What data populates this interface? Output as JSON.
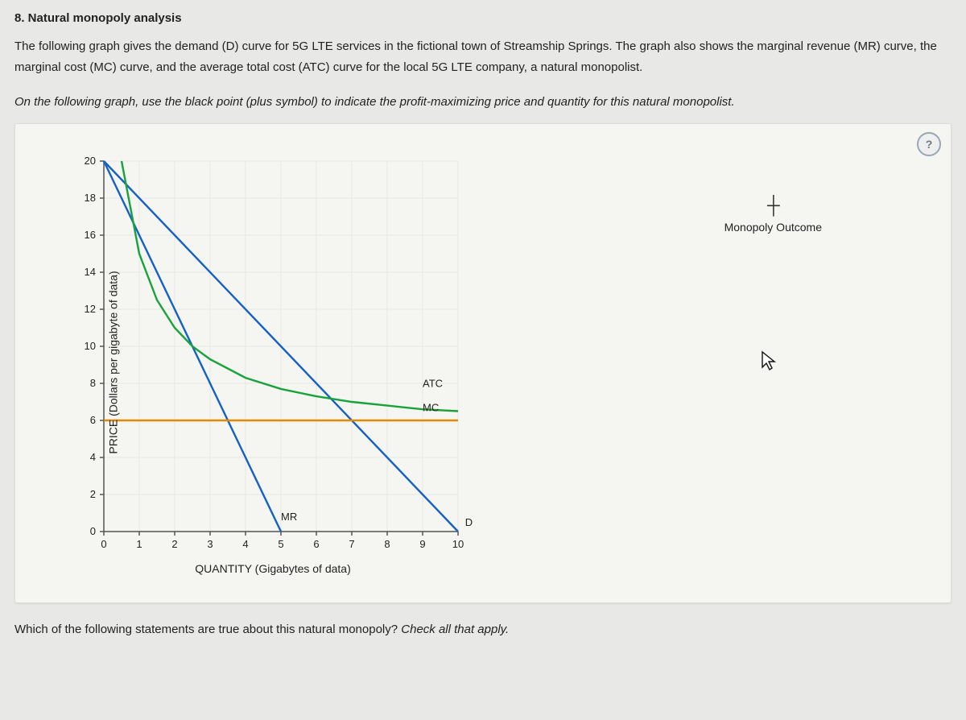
{
  "question": {
    "title": "8. Natural monopoly analysis",
    "body": "The following graph gives the demand (D) curve for 5G LTE services in the fictional town of Streamship Springs. The graph also shows the marginal revenue (MR) curve, the marginal cost (MC) curve, and the average total cost (ATC) curve for the local 5G LTE company, a natural monopolist.",
    "instruction": "On the following graph, use the black point (plus symbol) to indicate the profit-maximizing price and quantity for this natural monopolist.",
    "after_prompt": "Which of the following statements are true about this natural monopoly? ",
    "after_hint": "Check all that apply."
  },
  "help_label": "?",
  "legend": {
    "monopoly_label": "Monopoly Outcome"
  },
  "chart_data": {
    "type": "line",
    "xlabel": "QUANTITY (Gigabytes of data)",
    "ylabel": "PRICE (Dollars per gigabyte of data)",
    "xlim": [
      0,
      10
    ],
    "ylim": [
      0,
      20
    ],
    "x_ticks": [
      0,
      1,
      2,
      3,
      4,
      5,
      6,
      7,
      8,
      9,
      10
    ],
    "y_ticks": [
      0,
      2,
      4,
      6,
      8,
      10,
      12,
      14,
      16,
      18,
      20
    ],
    "series": [
      {
        "name": "D",
        "label": "D",
        "color": "#1560c7",
        "points": [
          [
            0,
            20
          ],
          [
            10,
            0
          ]
        ]
      },
      {
        "name": "MR",
        "label": "MR",
        "color": "#1560c7",
        "points": [
          [
            0,
            20
          ],
          [
            5,
            0
          ]
        ]
      },
      {
        "name": "MC",
        "label": "MC",
        "color": "#e38b00",
        "points": [
          [
            0,
            6
          ],
          [
            10,
            6
          ]
        ]
      },
      {
        "name": "ATC",
        "label": "ATC",
        "color": "#18a33a",
        "points": [
          [
            0.5,
            20
          ],
          [
            1,
            15
          ],
          [
            1.5,
            12.5
          ],
          [
            2,
            11
          ],
          [
            2.5,
            10
          ],
          [
            3,
            9.3
          ],
          [
            4,
            8.3
          ],
          [
            5,
            7.7
          ],
          [
            6,
            7.3
          ],
          [
            7,
            7.0
          ],
          [
            8,
            6.8
          ],
          [
            9,
            6.6
          ],
          [
            10,
            6.5
          ]
        ]
      }
    ],
    "curve_labels": {
      "D": {
        "x": 10.2,
        "y": 0.3
      },
      "MR": {
        "x": 5.0,
        "y": 0.6
      },
      "MC": {
        "x": 9.0,
        "y": 6.5
      },
      "ATC": {
        "x": 9.0,
        "y": 7.8
      }
    }
  }
}
